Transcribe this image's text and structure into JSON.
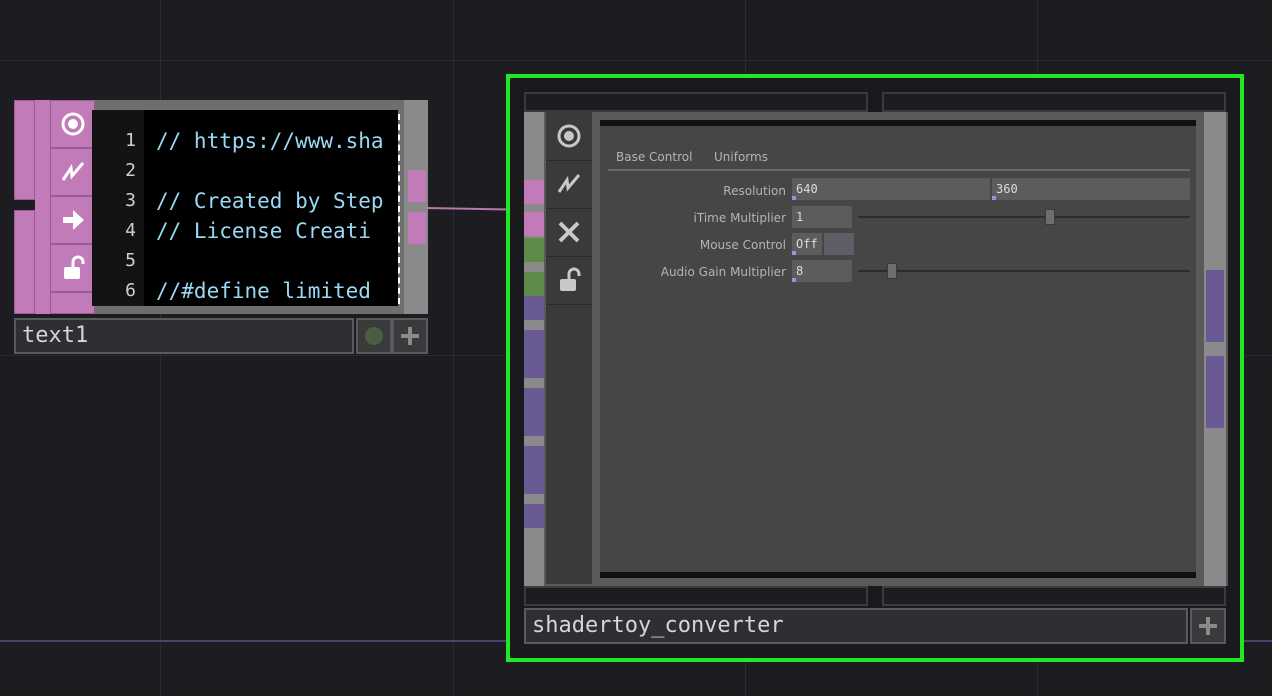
{
  "text_node": {
    "name": "text1",
    "code_lines": [
      {
        "num": "1",
        "text": "// https://www.sha"
      },
      {
        "num": "2",
        "text": ""
      },
      {
        "num": "3",
        "text": "// Created by Step"
      },
      {
        "num": "4",
        "text": "// License Creati"
      },
      {
        "num": "5",
        "text": ""
      },
      {
        "num": "6",
        "text": "//#define limited"
      }
    ],
    "icons": [
      "view-icon",
      "cook-icon",
      "export-icon",
      "lock-icon"
    ]
  },
  "shader_node": {
    "name": "shadertoy_converter",
    "icons": [
      "view-icon",
      "cook-icon",
      "bypass-icon",
      "lock-icon"
    ],
    "panel": {
      "tabs": [
        "Base Control",
        "Uniforms"
      ],
      "params": {
        "resolution": {
          "label": "Resolution",
          "x": "640",
          "y": "360"
        },
        "itime": {
          "label": "iTime Multiplier",
          "value": "1",
          "slider_fraction": 0.58
        },
        "mouse": {
          "label": "Mouse Control",
          "value": "Off"
        },
        "audio": {
          "label": "Audio Gain Multiplier",
          "value": "8",
          "slider_fraction": 0.09
        }
      }
    }
  },
  "colors": {
    "selection": "#22e822",
    "text_node": "#c27bb9",
    "code_text": "#9ad9f4",
    "connector_purple": "#6a5a94",
    "connector_green": "#5e8c48"
  }
}
